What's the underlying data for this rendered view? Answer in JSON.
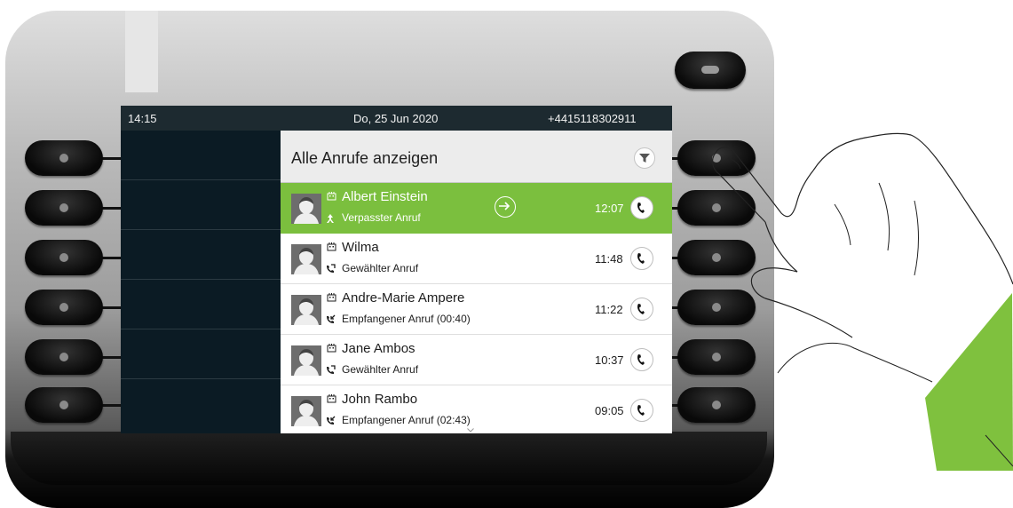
{
  "status": {
    "time": "14:15",
    "date": "Do, 25 Jun 2020",
    "number": "+4415118302911"
  },
  "list": {
    "title": "Alle Anrufe anzeigen",
    "filter_icon": "filter-icon",
    "items": [
      {
        "name": "Albert Einstein",
        "call_type": "Verpasster Anruf",
        "time": "12:07",
        "type_icon": "missed-call-icon",
        "selected": true
      },
      {
        "name": "Wilma",
        "call_type": "Gewählter Anruf",
        "time": "11:48",
        "type_icon": "outgoing-call-icon",
        "selected": false
      },
      {
        "name": "Andre-Marie Ampere",
        "call_type": "Empfangener Anruf (00:40)",
        "time": "11:22",
        "type_icon": "incoming-call-icon",
        "selected": false
      },
      {
        "name": "Jane Ambos",
        "call_type": "Gewählter Anruf",
        "time": "10:37",
        "type_icon": "outgoing-call-icon",
        "selected": false
      },
      {
        "name": "John Rambo",
        "call_type": "Empfangener Anruf (02:43)",
        "time": "09:05",
        "type_icon": "incoming-call-icon",
        "selected": false
      }
    ]
  },
  "colors": {
    "selection_green": "#7bbf3e",
    "screen_background": "#0b1b24",
    "statusbar": "#1d2a30",
    "wrist_green": "#7fc13e"
  }
}
